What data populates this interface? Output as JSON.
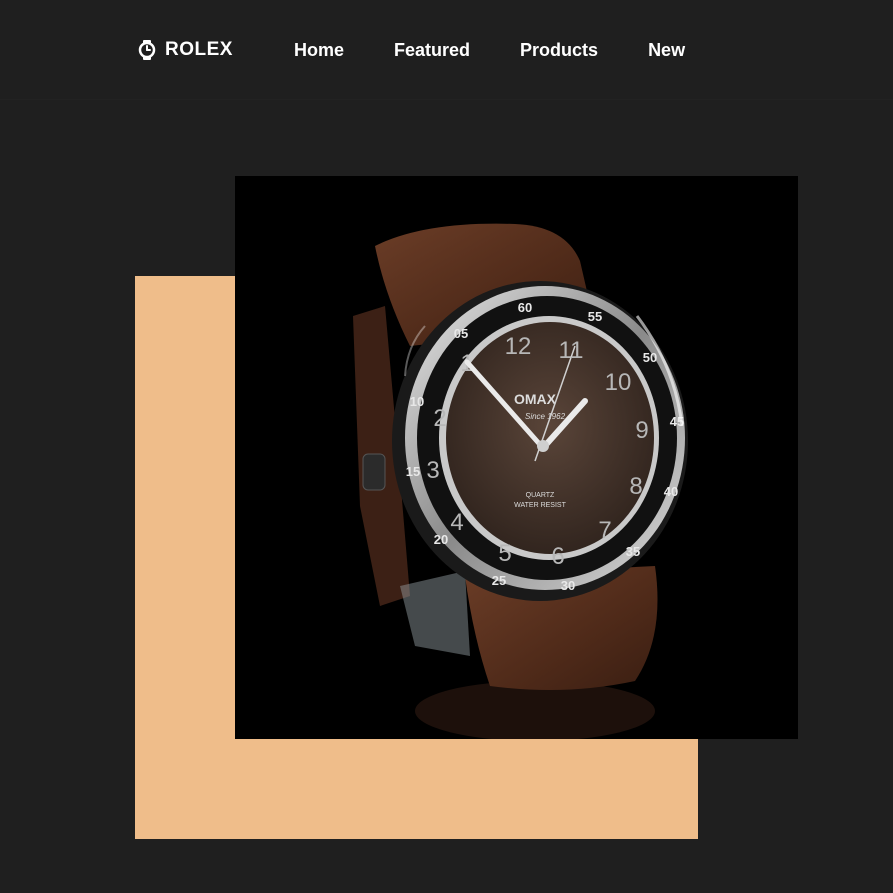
{
  "nav": {
    "brand": "ROLEX",
    "brand_icon": "watch-icon",
    "links": [
      "Home",
      "Featured",
      "Products",
      "New"
    ]
  },
  "hero": {
    "accent_color": "#efbd8a",
    "image": {
      "subject": "watch-product-photo",
      "background": "#000000",
      "dial_text": {
        "brand": "OMAX",
        "tagline": "Since 1962",
        "line1": "QUARTZ",
        "line2": "WATER RESIST"
      },
      "bezel_numbers": [
        "60",
        "55",
        "50",
        "45",
        "40",
        "35",
        "30",
        "25",
        "20",
        "15",
        "10",
        "05"
      ]
    }
  },
  "colors": {
    "page_bg": "#1f1f1f",
    "text": "#ffffff",
    "accent": "#efbd8a"
  }
}
